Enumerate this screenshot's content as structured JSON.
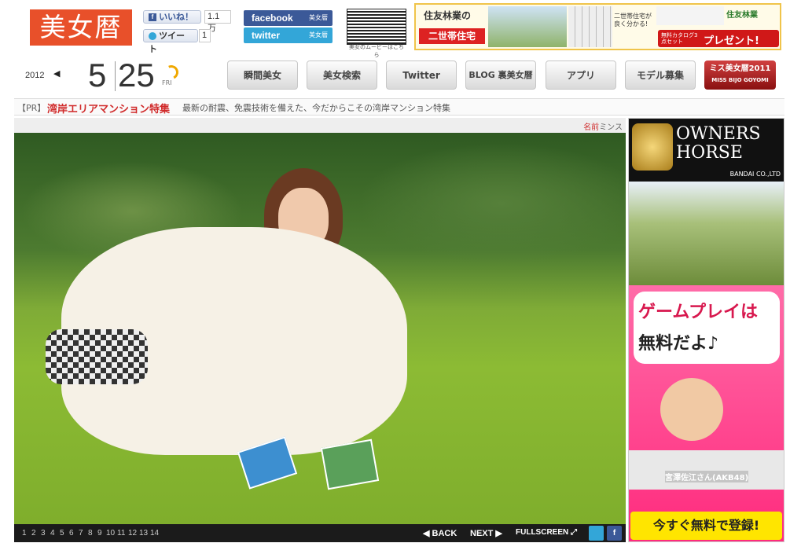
{
  "header": {
    "logo_text": "美女暦",
    "like_label": "いいね！",
    "like_count": "1.1万",
    "tweet_label": "ツイート",
    "tweet_count": "1",
    "facebook_label": "facebook",
    "facebook_sub": "美女暦",
    "twitter_label": "twitter",
    "twitter_sub": "美女暦",
    "qr_caption": "美女のムービーはこちら"
  },
  "top_ad": {
    "brand": "住友林業の",
    "product": "二世帯住宅",
    "note": "二世帯住宅が良く分かる!",
    "catalog": "無料カタログ3点セット",
    "present": "プレゼント!",
    "company": "住友林業"
  },
  "date": {
    "year": "2012",
    "month": "5",
    "day": "25",
    "weekday": "FRI"
  },
  "nav": [
    {
      "label": "瞬間美女"
    },
    {
      "label": "美女検索"
    },
    {
      "label": "Twitter"
    },
    {
      "label": "BLOG 裏美女暦"
    },
    {
      "label": "アプリ"
    },
    {
      "label": "モデル募集"
    }
  ],
  "miss_button": {
    "line1": "ミス美女暦2011",
    "line2": "MISS BIJO GOYOMI"
  },
  "pr": {
    "tag": "【PR】",
    "link": "湾岸エリアマンション特集",
    "desc": "最新の耐震、免震技術を備えた、今だからこその湾岸マンション特集"
  },
  "photo": {
    "name_label": "名前",
    "name": "ミンス",
    "pages": [
      "1",
      "2",
      "3",
      "4",
      "5",
      "6",
      "7",
      "8",
      "9",
      "10",
      "11",
      "12",
      "13",
      "14"
    ],
    "back": "BACK",
    "next": "NEXT",
    "fullscreen": "FULLSCREEN"
  },
  "banner": {
    "brand_line1": "OWNERS",
    "brand_line2": "HORSE",
    "company": "BANDAI CO.,LTD",
    "catch1": "ゲームプレイは",
    "catch2": "無料だよ♪",
    "person": "宮澤佐江さん(AKB48)",
    "cta": "今すぐ無料で登録!"
  },
  "colors": {
    "logo": "#e8502a",
    "facebook": "#3b5998",
    "twitter": "#33a6d8",
    "pr_link": "#d02a2a",
    "miss": "#9a1515",
    "banner_pink": "#ff3c8a"
  }
}
